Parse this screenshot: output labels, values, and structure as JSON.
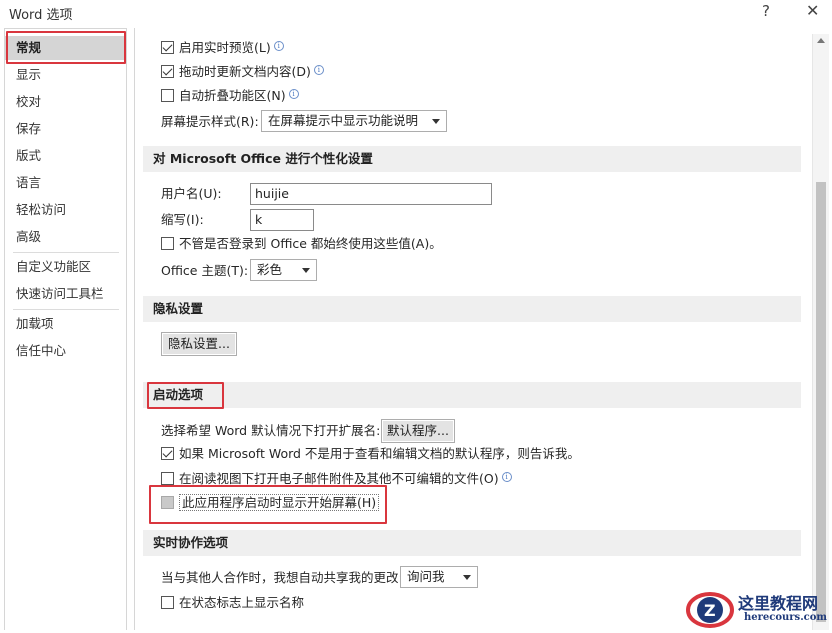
{
  "window": {
    "title": "Word 选项",
    "help_label": "?",
    "close_label": "✕"
  },
  "sidebar": {
    "items": [
      {
        "label": "常规"
      },
      {
        "label": "显示"
      },
      {
        "label": "校对"
      },
      {
        "label": "保存"
      },
      {
        "label": "版式"
      },
      {
        "label": "语言"
      },
      {
        "label": "轻松访问"
      },
      {
        "label": "高级"
      },
      {
        "label": "自定义功能区"
      },
      {
        "label": "快速访问工具栏"
      },
      {
        "label": "加载项"
      },
      {
        "label": "信任中心"
      }
    ]
  },
  "ui_options": {
    "live_preview": {
      "label": "启用实时预览(L)",
      "checked": true
    },
    "update_on_drag": {
      "label": "拖动时更新文档内容(D)",
      "checked": true
    },
    "collapse_ribbon": {
      "label": "自动折叠功能区(N)",
      "checked": false
    },
    "screentip_label": "屏幕提示样式(R):",
    "screentip_value": "在屏幕提示中显示功能说明"
  },
  "personalize": {
    "heading": "对 Microsoft Office 进行个性化设置",
    "username_label": "用户名(U):",
    "username_value": "huijie",
    "initials_label": "缩写(I):",
    "initials_value": "k",
    "always_use_label": "不管是否登录到 Office 都始终使用这些值(A)。",
    "always_use_checked": false,
    "theme_label": "Office 主题(T):",
    "theme_value": "彩色"
  },
  "privacy": {
    "heading": "隐私设置",
    "button_label": "隐私设置..."
  },
  "startup": {
    "heading": "启动选项",
    "default_program_label": "选择希望 Word 默认情况下打开扩展名:",
    "default_program_button": "默认程序...",
    "tell_me_label": "如果 Microsoft Word 不是用于查看和编辑文档的默认程序，则告诉我。",
    "tell_me_checked": true,
    "reading_view_label": "在阅读视图下打开电子邮件附件及其他不可编辑的文件(O)",
    "reading_view_checked": false,
    "start_screen_label": "此应用程序启动时显示开始屏幕(H)",
    "start_screen_checked": false
  },
  "coauthoring": {
    "heading": "实时协作选项",
    "share_label": "当与其他人合作时，我想自动共享我的更改:",
    "share_value": "询问我",
    "show_names_label": "在状态标志上显示名称",
    "show_names_checked": false
  },
  "watermark": {
    "text": "这里教程网",
    "sub": "herecours.com",
    "logo_letter": "Z"
  }
}
